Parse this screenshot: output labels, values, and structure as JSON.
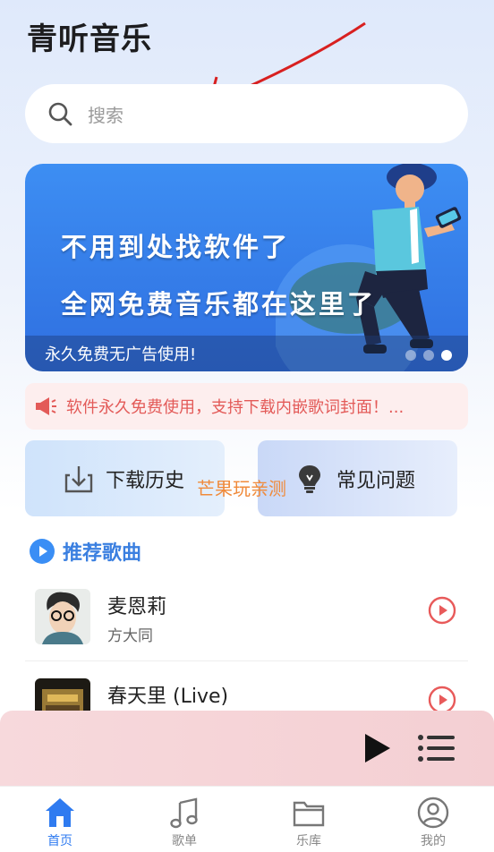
{
  "app": {
    "title": "青听音乐"
  },
  "search": {
    "placeholder": "搜索"
  },
  "banner": {
    "line1": "不用到处找软件了",
    "line2": "全网免费音乐都在这里了",
    "caption": "永久免费无广告使用!",
    "dots_count": 3,
    "active_dot": 3
  },
  "notice": {
    "text": "软件永久免费使用，支持下载内嵌歌词封面！..."
  },
  "quick_actions": [
    {
      "label": "下载历史",
      "icon": "download-icon"
    },
    {
      "label": "常见问题",
      "icon": "lightbulb-icon"
    }
  ],
  "watermark": "芒果玩亲测",
  "recommended": {
    "title": "推荐歌曲",
    "songs": [
      {
        "name": "麦恩莉",
        "artist": "方大同"
      },
      {
        "name": "春天里 (Live)",
        "artist": ""
      }
    ]
  },
  "tabs": [
    {
      "label": "首页",
      "icon": "home-icon",
      "active": true
    },
    {
      "label": "歌单",
      "icon": "music-note-icon",
      "active": false
    },
    {
      "label": "乐库",
      "icon": "folder-icon",
      "active": false
    },
    {
      "label": "我的",
      "icon": "user-icon",
      "active": false
    }
  ],
  "colors": {
    "accent": "#2f7bf0",
    "notice_text": "#e35a58",
    "play_icon": "#e85a5a",
    "watermark": "#f08a3a"
  }
}
